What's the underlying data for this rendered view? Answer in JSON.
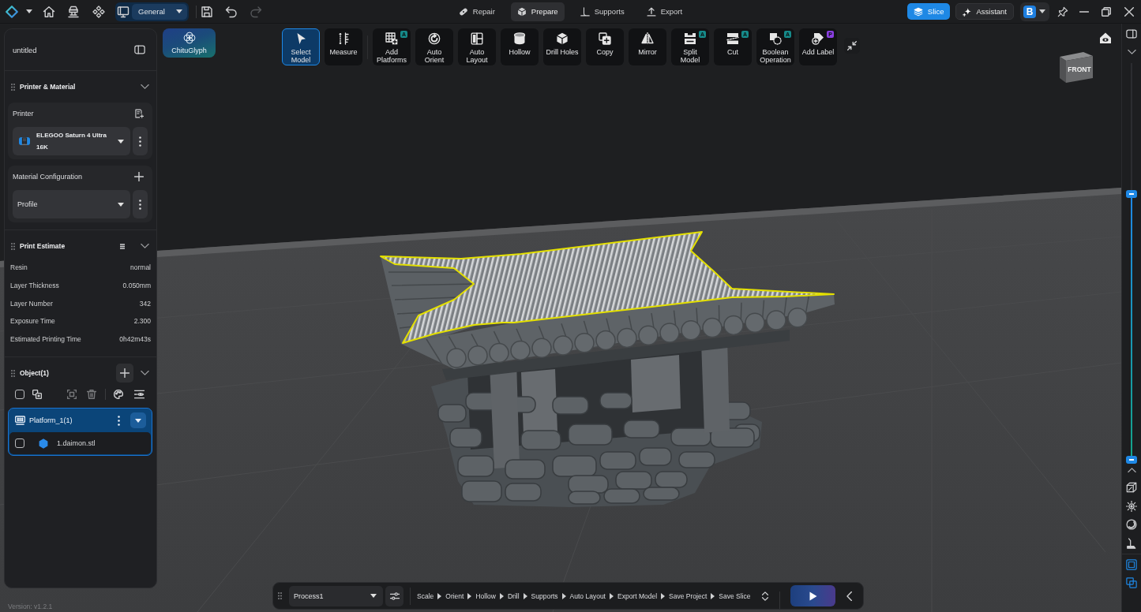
{
  "title_bar": {
    "workspace": "General",
    "history": [
      {
        "kind": "undo",
        "disabled": false
      },
      {
        "kind": "redo",
        "disabled": true
      }
    ],
    "modes": [
      {
        "kind": "repair",
        "label": "Repair",
        "selected": false
      },
      {
        "kind": "prepare",
        "label": "Prepare",
        "selected": true
      },
      {
        "kind": "supports",
        "label": "Supports",
        "selected": false
      },
      {
        "kind": "export",
        "label": "Export",
        "selected": false
      }
    ],
    "slice_button": "Slice",
    "assistant_button": "Assistant",
    "account_initial": "B"
  },
  "project_panel": {
    "project_name": "untitled",
    "printer_material": {
      "title": "Printer & Material",
      "printer_label": "Printer",
      "printer": "ELEGOO Saturn 4 Ultra 16K",
      "material_label": "Material Configuration",
      "profile": "Profile"
    },
    "print_estimate": {
      "title": "Print Estimate",
      "rows": [
        {
          "label": "Resin",
          "value": "normal"
        },
        {
          "label": "Layer Thickness",
          "value": "0.050mm"
        },
        {
          "label": "Layer Number",
          "value": "342"
        },
        {
          "label": "Exposure Time",
          "value": "2.300"
        },
        {
          "label": "Estimated Printing Time",
          "value": "0h42m43s"
        }
      ]
    },
    "objects": {
      "title": "Object(1)",
      "select_all_checked": false,
      "platforms": [
        {
          "name": "Platform_1(1)",
          "selected": true,
          "children": [
            {
              "name": "1.daimon.stl",
              "checked": false
            }
          ]
        }
      ]
    }
  },
  "toolbar": {
    "chituglyph_button": "ChituGlyph",
    "tool_groups": [
      [
        {
          "kind": "select",
          "label": "Select Model",
          "selected": true
        },
        {
          "kind": "measure",
          "label": "Measure",
          "selected": false
        }
      ],
      [
        {
          "kind": "add_platforms",
          "label": "Add Platforms",
          "selected": false,
          "badge": {
            "text": "A",
            "color": "#168a8a"
          }
        },
        {
          "kind": "auto_orient",
          "label": "Auto Orient",
          "selected": false
        },
        {
          "kind": "auto_layout",
          "label": "Auto Layout",
          "selected": false
        },
        {
          "kind": "hollow",
          "label": "Hollow",
          "selected": false
        },
        {
          "kind": "drill",
          "label": "Drill Holes",
          "selected": false
        },
        {
          "kind": "copy",
          "label": "Copy",
          "selected": false
        },
        {
          "kind": "mirror",
          "label": "Mirror",
          "selected": false
        },
        {
          "kind": "split",
          "label": "Split Model",
          "selected": false,
          "badge": {
            "text": "A",
            "color": "#168a8a"
          }
        },
        {
          "kind": "cut",
          "label": "Cut",
          "selected": false,
          "badge": {
            "text": "A",
            "color": "#168a8a"
          }
        },
        {
          "kind": "boolean",
          "label": "Boolean Operation",
          "selected": false,
          "badge": {
            "text": "A",
            "color": "#168a8a"
          }
        },
        {
          "kind": "label",
          "label": "Add Label",
          "selected": false,
          "badge": {
            "text": "P",
            "color": "#8a3ee0"
          }
        }
      ]
    ]
  },
  "view_cube": {
    "label": "FRONT"
  },
  "layer_slider": {
    "level": 0.67
  },
  "workflow_bar": {
    "process": "Process1",
    "steps": [
      "Scale",
      "Orient",
      "Hollow",
      "Drill",
      "Supports",
      "Auto Layout",
      "Export Model",
      "Save Project",
      "Save Slice"
    ]
  },
  "version": "Version: v1.2.1"
}
